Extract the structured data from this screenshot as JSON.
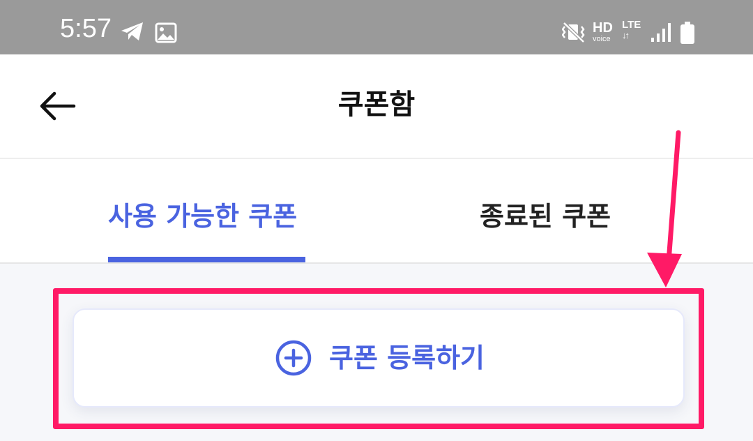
{
  "status_bar": {
    "time": "5:57",
    "hd": "HD",
    "voice": "voice",
    "lte": "LTE",
    "lte_arrows": "↓↑",
    "icons": [
      "telegram-icon",
      "image-icon",
      "vibrate-icon",
      "signal-icon",
      "battery-icon"
    ]
  },
  "header": {
    "back_icon": "back-arrow-icon",
    "title": "쿠폰함"
  },
  "tabs": [
    {
      "label": "사용 가능한 쿠폰",
      "selected": true
    },
    {
      "label": "종료된 쿠폰",
      "selected": false
    }
  ],
  "main": {
    "register_button": {
      "icon": "plus-circle-icon",
      "label": "쿠폰 등록하기"
    }
  },
  "colors": {
    "accent": "#4a63e0",
    "annotation": "#ff1a66",
    "status_bar": "#9a9a9a"
  }
}
